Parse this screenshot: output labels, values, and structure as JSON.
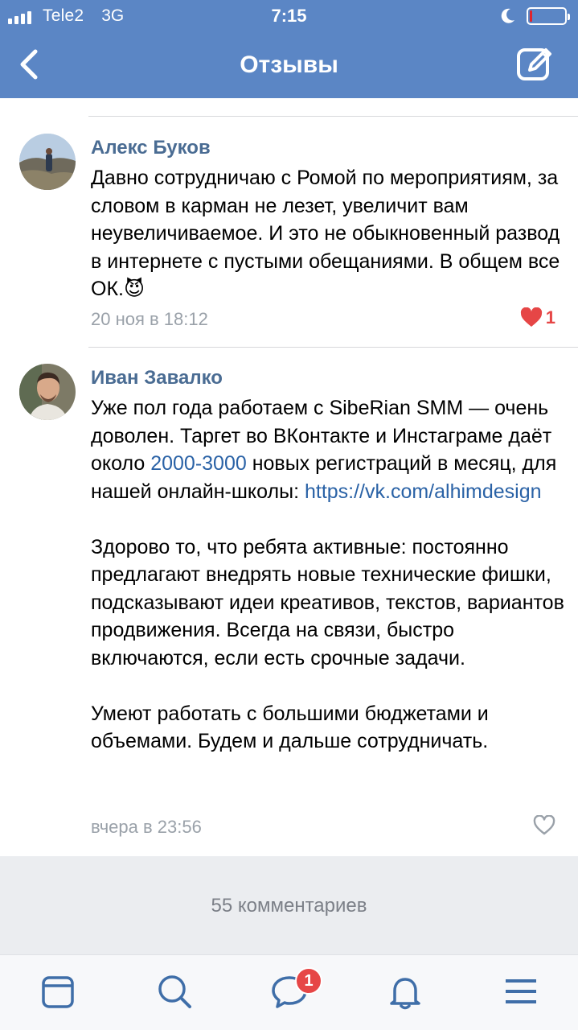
{
  "status_bar": {
    "carrier": "Tele2",
    "network": "3G",
    "time": "7:15",
    "battery_level": 0.05
  },
  "nav": {
    "title": "Отзывы",
    "back_icon": "chevron-left-icon",
    "compose_icon": "compose-icon"
  },
  "comments": [
    {
      "author": "Алекс Буков",
      "text": "Давно сотрудничаю с Ромой по мероприятиям, за словом в карман не лезет, увеличит вам неувеличиваемое. И это не обыкновенный развод в интернете с пустыми  обещаниями. В общем все ОК.",
      "emoji": "😈",
      "time": "20 ноя в 18:12",
      "likes": "1",
      "liked": true
    },
    {
      "author": "Иван Завалко",
      "text_p1_a": "Уже пол года работаем с SibeRian SMM — очень доволен. Таргет во ВКонтакте и Инстаграме даёт около ",
      "text_p1_num": "2000-3000",
      "text_p1_b": " новых регистраций в месяц, для нашей онлайн-школы: ",
      "text_p1_link": "https://vk.com/alhimdesign",
      "text_p2": "Здорово то, что ребята активные: постоянно предлагают внедрять новые технические фишки, подсказывают идеи креативов, текстов, вариантов продвижения. Всегда на связи, быстро включаются, если есть срочные задачи.",
      "text_p3": "Умеют работать с большими бюджетами и объемами. Будем и дальше сотрудничать.",
      "time": "вчера в 23:56",
      "liked": false
    }
  ],
  "comments_count": "55 комментариев",
  "tabbar": {
    "items": [
      "news-icon",
      "search-icon",
      "messages-icon",
      "notifications-icon",
      "menu-icon"
    ],
    "messages_badge": "1"
  },
  "colors": {
    "header": "#5b86c5",
    "author": "#4a6c93",
    "link": "#2a62a6",
    "like": "#e64646",
    "tab_icon": "#3f6ea8"
  }
}
